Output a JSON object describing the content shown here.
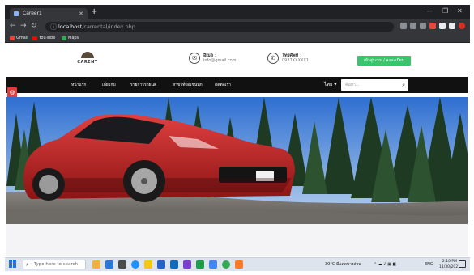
{
  "browser": {
    "tab_title": "Career1",
    "url_host": "localhost",
    "url_path": "/carrental/index.php",
    "bookmarks": [
      "Gmail",
      "YouTube",
      "Maps"
    ]
  },
  "site": {
    "brand": "CARENT",
    "contact_email": {
      "label": "อีเมล :",
      "value": "info@gmail.com"
    },
    "contact_phone": {
      "label": "โทรศัพท์ :",
      "value": "0937XXXXX1"
    },
    "cta_label": "เข้าสู่ระบบ / ลงทะเบียน",
    "nav": [
      "หน้าแรก",
      "เกี่ยวกับ",
      "รายการรถยนต์",
      "สาขาที่ขอเช่นทุก",
      "ติดต่อเรา"
    ],
    "lang_button": "ไทย ▾",
    "search_placeholder": "ค้นหา..."
  },
  "taskbar": {
    "search_placeholder": "Type here to search",
    "weather": "30°C  มีแดดบางส่วน",
    "lang": "ENG",
    "time": "2:10 PM",
    "date": "11/30/2021"
  },
  "colors": {
    "nav_bg": "#111111",
    "cta": "#3cc36b",
    "accent_red": "#e23b3b"
  }
}
